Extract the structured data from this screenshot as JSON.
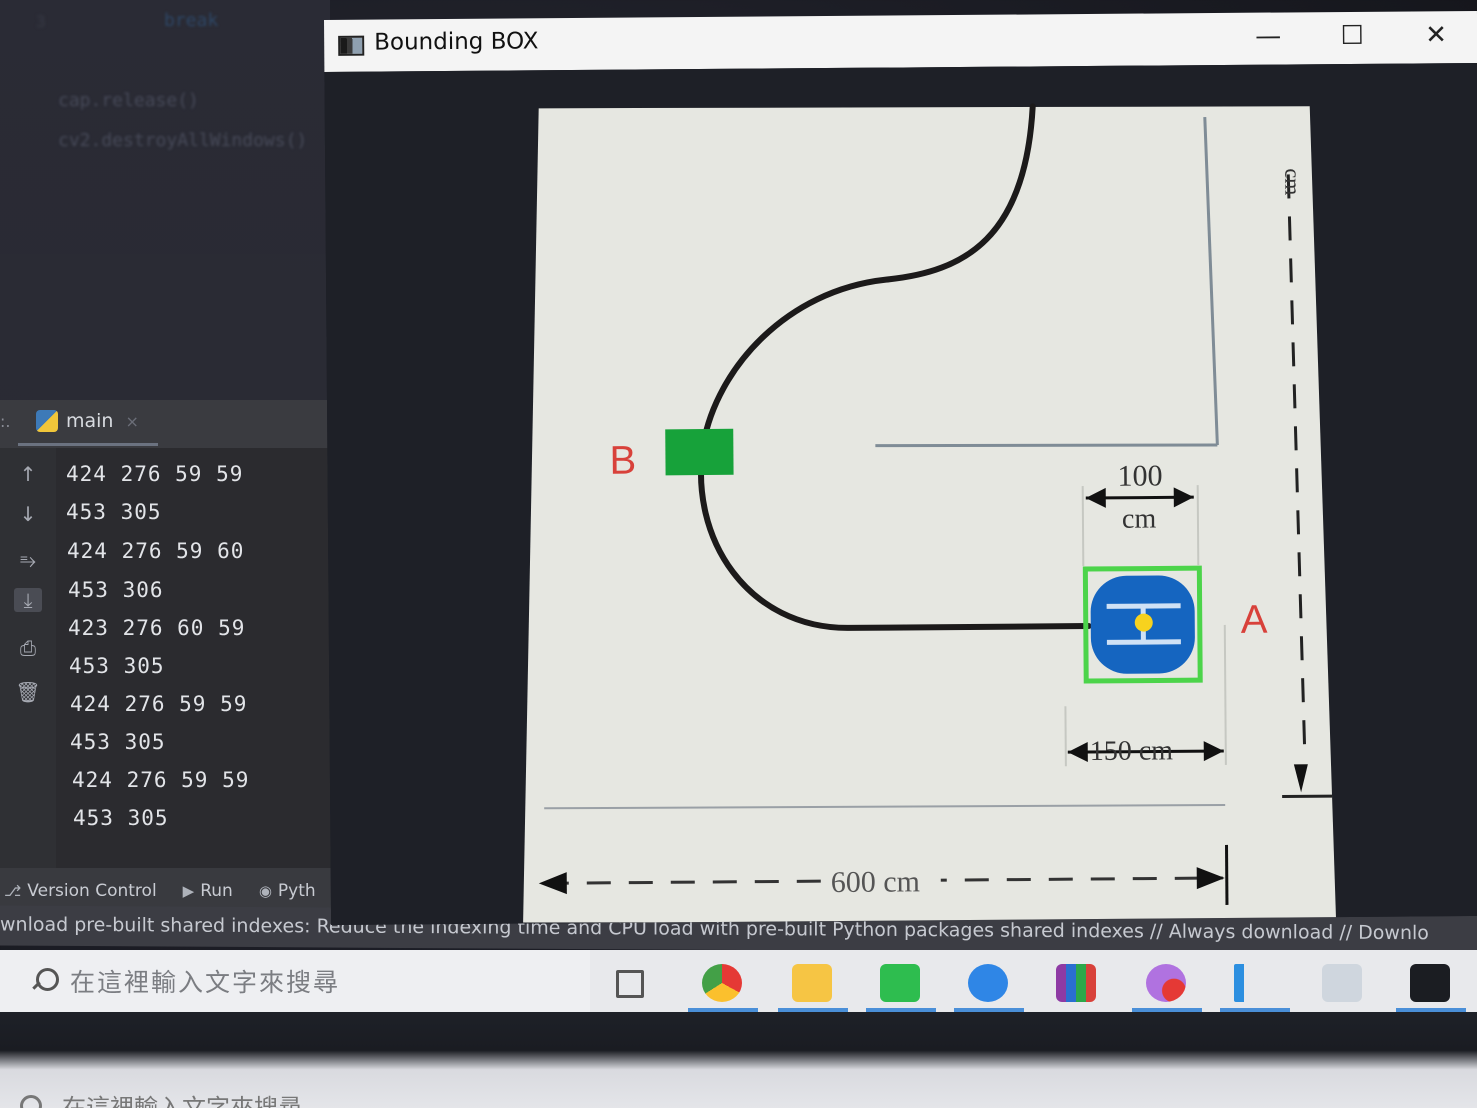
{
  "ide": {
    "code_lines": [
      "break",
      "cap.release()",
      "cv2.destroyAllWindows()"
    ],
    "run_panel": {
      "prefix": ":.",
      "tab_label": "main",
      "tab_close": "×",
      "console_lines": [
        "424 276 59 59",
        "453 305",
        "424 276 59 60",
        "453 306",
        "423 276 60 59",
        "453 305",
        "424 276 59 59",
        "453 305",
        "424 276 59 59",
        "453 305"
      ]
    },
    "bottom_tabs": [
      {
        "label": "Version Control",
        "icon": "version-control-icon"
      },
      {
        "label": "Run",
        "icon": "run-icon"
      },
      {
        "label": "Pyth",
        "icon": "python-packages-icon"
      }
    ],
    "status_message": "wnload pre-built shared indexes: Reduce the indexing time and CPU load with pre-built Python packages shared indexes // Always download // Downlo"
  },
  "window": {
    "title": "Bounding BOX",
    "controls": {
      "minimize": "—",
      "maximize": "☐",
      "close": "✕"
    },
    "scene": {
      "label_b": "B",
      "label_a": "A",
      "dim_100_top": "100",
      "dim_100_bottom": "cm",
      "dim_150": "150 cm",
      "dim_600": "600 cm",
      "dim_vertical": "cm",
      "colors": {
        "paper": "#e6e7e1",
        "track": "#1c1a1a",
        "label_red": "#d8413a",
        "target_green": "#17a23a",
        "robot_blue": "#1565c0",
        "bbox_green": "#4cd44a",
        "center_dot": "#f7d21e"
      }
    }
  },
  "taskbar": {
    "search_placeholder": "在這裡輸入文字來搜尋",
    "apps": [
      "task-view-icon",
      "chrome-icon",
      "file-explorer-icon",
      "line-icon",
      "signal-icon",
      "winrar-icon",
      "messenger-icon",
      "vscode-icon",
      "notepad-icon",
      "terminal-icon"
    ]
  },
  "bottom_reflection": {
    "search_text": "在這裡輸入文字來搜尋"
  }
}
